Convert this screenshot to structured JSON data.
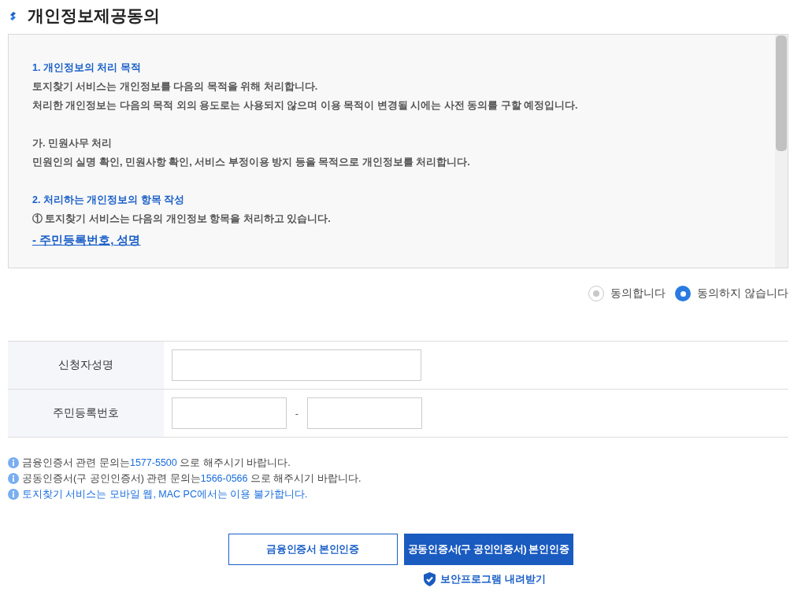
{
  "title": "개인정보제공동의",
  "consent_text": {
    "sections": [
      {
        "lines": [
          {
            "kind": "heading",
            "text": "1. 개인정보의 처리 목적"
          },
          {
            "kind": "text",
            "text": "토지찾기 서비스는 개인정보를 다음의 목적을 위해 처리합니다."
          },
          {
            "kind": "text",
            "text": "처리한 개인정보는 다음의 목적 외의 용도로는 사용되지 않으며 이용 목적이 변경될 시에는 사전 동의를 구할 예정입니다."
          }
        ]
      },
      {
        "lines": [
          {
            "kind": "text",
            "text": "가. 민원사무 처리"
          },
          {
            "kind": "text",
            "text": "민원인의 실명 확인, 민원사항 확인, 서비스 부정이용 방지 등을 목적으로 개인정보를 처리합니다."
          }
        ]
      },
      {
        "lines": [
          {
            "kind": "heading",
            "text": "2. 처리하는 개인정보의 항목 작성"
          },
          {
            "kind": "text",
            "text": "① 토지찾기 서비스는 다음의 개인정보 항목을 처리하고 있습니다."
          },
          {
            "kind": "link",
            "text": "- 주민등록번호, 성명"
          }
        ]
      }
    ]
  },
  "consent_options": [
    {
      "label": "동의합니다",
      "selected": false
    },
    {
      "label": "동의하지 않습니다",
      "selected": true
    }
  ],
  "form_rows": [
    {
      "label": "신청자성명",
      "kind": "single"
    },
    {
      "label": "주민등록번호",
      "kind": "split",
      "separator": "-"
    }
  ],
  "notices": [
    {
      "segments": [
        {
          "text": "금융인증서 관련 문의는",
          "highlight": false
        },
        {
          "text": "1577-5500",
          "highlight": true
        },
        {
          "text": " 으로 해주시기 바랍니다.",
          "highlight": false
        }
      ]
    },
    {
      "segments": [
        {
          "text": "공동인증서(구 공인인증서) 관련 문의는",
          "highlight": false
        },
        {
          "text": "1566-0566",
          "highlight": true
        },
        {
          "text": " 으로 해주시기 바랍니다.",
          "highlight": false
        }
      ]
    },
    {
      "segments": [
        {
          "text": "토지찾기 서비스는 모바일 웹, MAC PC에서는 이용 불가합니다.",
          "highlight": true
        }
      ]
    }
  ],
  "buttons": [
    {
      "label": "금융인증서 본인인증",
      "kind": "outline"
    },
    {
      "label": "공동인증서(구 공인인증서) 본인인증",
      "kind": "primary"
    }
  ],
  "download_link": "보안프로그램 내려받기"
}
